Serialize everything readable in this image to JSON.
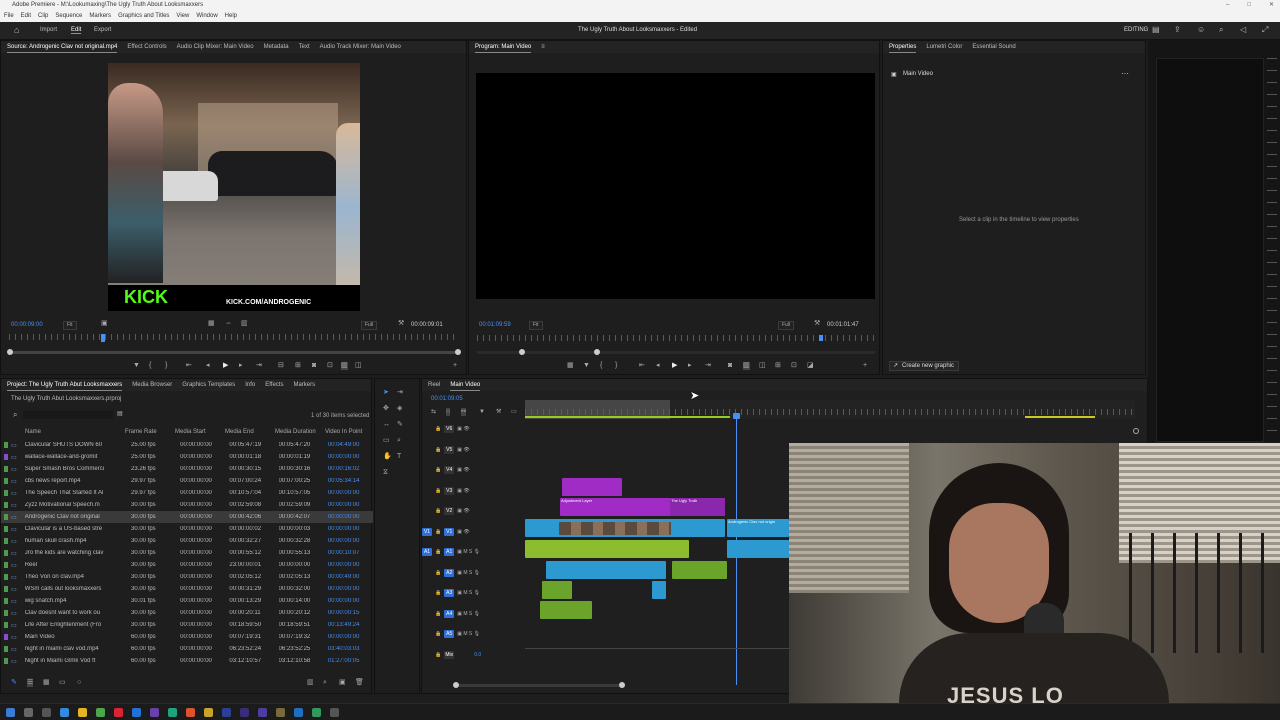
{
  "window": {
    "title": "Adobe Premiere - M:\\Lookumaxing\\The Ugly Truth About Looksmaxxers",
    "controls": [
      "–",
      "□",
      "✕"
    ]
  },
  "menu": [
    "File",
    "Edit",
    "Clip",
    "Sequence",
    "Markers",
    "Graphics and Titles",
    "View",
    "Window",
    "Help"
  ],
  "header": {
    "tabs": [
      "Import",
      "Edit",
      "Export"
    ],
    "active_tab": "Edit",
    "project_title": "The Ugly Truth About Looksmaxxers - Edited",
    "workspace": "EDITING"
  },
  "source_panel": {
    "tabs": [
      "Source: Androgenic Clav not original.mp4",
      "Effect Controls",
      "Audio Clip Mixer: Main Video",
      "Metadata",
      "Text",
      "Audio Track Mixer: Main Video"
    ],
    "video_text_brand": "KICK",
    "video_text_url": "KICK.COM/ANDROGENIC",
    "timecode_left": "00:00:09:00",
    "fit": "Fit",
    "quality": "Full",
    "timecode_right": "00:00:09:01"
  },
  "program_panel": {
    "tab": "Program: Main Video",
    "timecode_left": "00:01:09:59",
    "fit": "Fit",
    "quality": "Full",
    "timecode_right": "00:01:01:47"
  },
  "properties_panel": {
    "tabs": [
      "Properties",
      "Lumetri Color",
      "Essential Sound"
    ],
    "sequence": "Main Video",
    "hint": "Select a clip in the timeline to view properties",
    "create_button": "Create new graphic"
  },
  "project_panel": {
    "tabs": [
      "Project: The Ugly Truth Abut Looksmaxxers",
      "Media Browser",
      "Graphics Templates",
      "Info",
      "Effects",
      "Markers"
    ],
    "path": "The Ugly Truth Abut Looksmaxxers.prproj",
    "selection_info": "1 of 30 items selected",
    "columns": [
      "Name",
      "Frame Rate",
      "Media Start",
      "Media End",
      "Media Duration",
      "Video In Point"
    ],
    "rows": [
      {
        "name": "Clavicular SHUTS DOWN 60",
        "rate": "25.00 fps",
        "start": "00:00:00:00",
        "end": "00:05:47:19",
        "dur": "00:05:47:20",
        "in": "00:04:49:00",
        "color": "#4e9a4e"
      },
      {
        "name": "wallace-wallace-and-gromit",
        "rate": "25.00 fps",
        "start": "00:00:00:00",
        "end": "00:00:01:18",
        "dur": "00:00:01:19",
        "in": "00:00:00:00",
        "color": "#8a4ccf"
      },
      {
        "name": "Super Smash Bros Commerci",
        "rate": "23.26 fps",
        "start": "00:00:00:00",
        "end": "00:00:30:15",
        "dur": "00:00:30:16",
        "in": "00:00:16:02",
        "color": "#4e9a4e"
      },
      {
        "name": "cbs news report.mp4",
        "rate": "29.97 fps",
        "start": "00:00:00:00",
        "end": "00:07:00:24",
        "dur": "00:07:00:25",
        "in": "00:05:34:14",
        "color": "#4e9a4e"
      },
      {
        "name": "The Speech That Started It Al",
        "rate": "29.97 fps",
        "start": "00:00:00:00",
        "end": "00:10:57:04",
        "dur": "00:10:57:05",
        "in": "00:00:00:00",
        "color": "#4e9a4e"
      },
      {
        "name": "Zyzz Motivational Speech.m",
        "rate": "30.00 fps",
        "start": "00:00:00:00",
        "end": "00:02:59:08",
        "dur": "00:02:59:09",
        "in": "00:00:00:00",
        "color": "#4e9a4e"
      },
      {
        "name": "Androgenic Clav not original",
        "rate": "30.00 fps",
        "start": "00:00:00:00",
        "end": "00:00:42:06",
        "dur": "00:00:42:07",
        "in": "00:00:00:00",
        "color": "#4e9a4e",
        "selected": true
      },
      {
        "name": "Clavicular is a US-based stre",
        "rate": "30.00 fps",
        "start": "00:00:00:00",
        "end": "00:00:00:02",
        "dur": "00:00:00:03",
        "in": "00:00:00:00",
        "color": "#4e9a4e"
      },
      {
        "name": "human skull crash.mp4",
        "rate": "30.00 fps",
        "start": "00:00:00:00",
        "end": "00:00:32:27",
        "dur": "00:00:32:28",
        "in": "00:00:00:00",
        "color": "#4e9a4e"
      },
      {
        "name": "Jro the kids are watching clav",
        "rate": "30.00 fps",
        "start": "00:00:00:00",
        "end": "00:00:55:12",
        "dur": "00:00:55:13",
        "in": "00:00:10:07",
        "color": "#4e9a4e"
      },
      {
        "name": "Reel",
        "rate": "30.00 fps",
        "start": "00:00:00:00",
        "end": "23:00:00:01",
        "dur": "00:00:00:00",
        "in": "00:00:00:00",
        "color": "#4e9a4e"
      },
      {
        "name": "Theo Von on clav.mp4",
        "rate": "30.00 fps",
        "start": "00:00:00:00",
        "end": "00:02:05:12",
        "dur": "00:02:05:13",
        "in": "00:00:49:00",
        "color": "#4e9a4e"
      },
      {
        "name": "WSm calls out looksmaxxers",
        "rate": "30.00 fps",
        "start": "00:00:00:00",
        "end": "00:00:31:29",
        "dur": "00:00:32:00",
        "in": "00:00:00:00",
        "color": "#4e9a4e"
      },
      {
        "name": "wig snatch.mp4",
        "rate": "30.01 fps",
        "start": "00:00:00:00",
        "end": "00:00:13:29",
        "dur": "00:00:14:00",
        "in": "00:00:00:00",
        "color": "#4e9a4e"
      },
      {
        "name": "Clav doesnt want to work ou",
        "rate": "30.00 fps",
        "start": "00:00:00:00",
        "end": "00:00:20:11",
        "dur": "00:00:20:12",
        "in": "00:00:00:15",
        "color": "#4e9a4e"
      },
      {
        "name": "Life After Enlightenment (Fro",
        "rate": "30.00 fps",
        "start": "00:00:00:00",
        "end": "00:18:59:50",
        "dur": "00:18:59:51",
        "in": "00:13:49:24",
        "color": "#4e9a4e"
      },
      {
        "name": "Main Video",
        "rate": "60.00 fps",
        "start": "00:00:00:00",
        "end": "00:07:19:31",
        "dur": "00:07:19:32",
        "in": "00:00:00:00",
        "color": "#8a4ccf"
      },
      {
        "name": "night in miami clav vod.mp4",
        "rate": "60.00 fps",
        "start": "00:00:00:00",
        "end": "06:23:52:24",
        "dur": "06:23:52:25",
        "in": "03:40:03:03",
        "color": "#4e9a4e"
      },
      {
        "name": "Night in Miami Glmk Vod ft",
        "rate": "60.00 fps",
        "start": "00:00:00:00",
        "end": "03:12:10:57",
        "dur": "03:12:10:58",
        "in": "01:27:00:05",
        "color": "#4e9a4e"
      }
    ]
  },
  "timeline": {
    "tabs": [
      "Reel",
      "Main Video"
    ],
    "active_tab": "Main Video",
    "timecode": "00:01:09:05",
    "tracks": [
      "V6",
      "V5",
      "V4",
      "V3",
      "V2",
      "V1",
      "A1",
      "A2",
      "A3",
      "A4",
      "A5",
      "Mix"
    ],
    "mix_value": "0.0",
    "clip_labels": {
      "adjustment": "Adjustment Layer",
      "ugly": "The Ugly Truth",
      "androgenic": "Androgenic Clav not origin"
    }
  },
  "webcam": {
    "shirt_text": "JESUS LO"
  },
  "colors": {
    "accent": "#4a8ff5",
    "video_clip": "#2c9ad1",
    "audio_clip": "#8bbd2e",
    "adjustment": "#a12cc5",
    "kick_green": "#53fc18"
  }
}
